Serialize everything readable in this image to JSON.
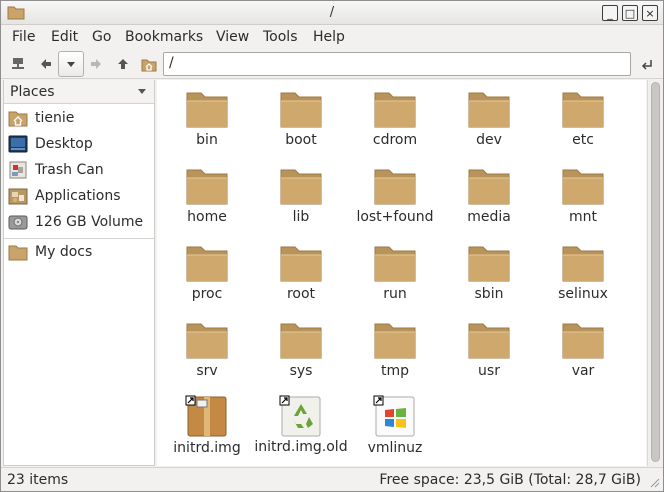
{
  "window": {
    "title": "/"
  },
  "window_buttons": {
    "minimize": "_",
    "maximize": "□",
    "close": "×"
  },
  "menu": [
    {
      "label": "File"
    },
    {
      "label": "Edit"
    },
    {
      "label": "Go"
    },
    {
      "label": "Bookmarks"
    },
    {
      "label": "View"
    },
    {
      "label": "Tools"
    },
    {
      "label": "Help"
    }
  ],
  "toolbar": {
    "buttons": [
      "connect-icon",
      "back-icon",
      "history-dropdown-icon",
      "forward-icon",
      "up-icon",
      "home-icon"
    ],
    "location_value": "/",
    "go_icon": "enter-icon"
  },
  "sidebar": {
    "header": "Places",
    "items": [
      {
        "label": "tienie",
        "icon": "home-folder-icon"
      },
      {
        "label": "Desktop",
        "icon": "desktop-icon"
      },
      {
        "label": "Trash Can",
        "icon": "trash-icon"
      },
      {
        "label": "Applications",
        "icon": "applications-icon"
      },
      {
        "label": "126 GB Volume",
        "icon": "drive-icon"
      }
    ],
    "bookmarks": [
      {
        "label": "My docs",
        "icon": "folder-icon"
      }
    ]
  },
  "files": [
    {
      "name": "bin",
      "type": "folder"
    },
    {
      "name": "boot",
      "type": "folder"
    },
    {
      "name": "cdrom",
      "type": "folder"
    },
    {
      "name": "dev",
      "type": "folder"
    },
    {
      "name": "etc",
      "type": "folder"
    },
    {
      "name": "home",
      "type": "folder"
    },
    {
      "name": "lib",
      "type": "folder"
    },
    {
      "name": "lost+found",
      "type": "folder"
    },
    {
      "name": "media",
      "type": "folder"
    },
    {
      "name": "mnt",
      "type": "folder"
    },
    {
      "name": "proc",
      "type": "folder"
    },
    {
      "name": "root",
      "type": "folder"
    },
    {
      "name": "run",
      "type": "folder"
    },
    {
      "name": "sbin",
      "type": "folder"
    },
    {
      "name": "selinux",
      "type": "folder"
    },
    {
      "name": "srv",
      "type": "folder"
    },
    {
      "name": "sys",
      "type": "folder"
    },
    {
      "name": "tmp",
      "type": "folder"
    },
    {
      "name": "usr",
      "type": "folder"
    },
    {
      "name": "var",
      "type": "folder"
    },
    {
      "name": "initrd.img",
      "type": "archive-link"
    },
    {
      "name": "initrd.img.old",
      "type": "recycle-link"
    },
    {
      "name": "vmlinuz",
      "type": "windows-link"
    }
  ],
  "status": {
    "items": "23 items",
    "free_space": "Free space: 23,5 GiB (Total: 28,7 GiB)"
  },
  "colors": {
    "folder": "#c9a36a",
    "folder_dark": "#a9834c",
    "window_bg": "#f2f1f0"
  }
}
